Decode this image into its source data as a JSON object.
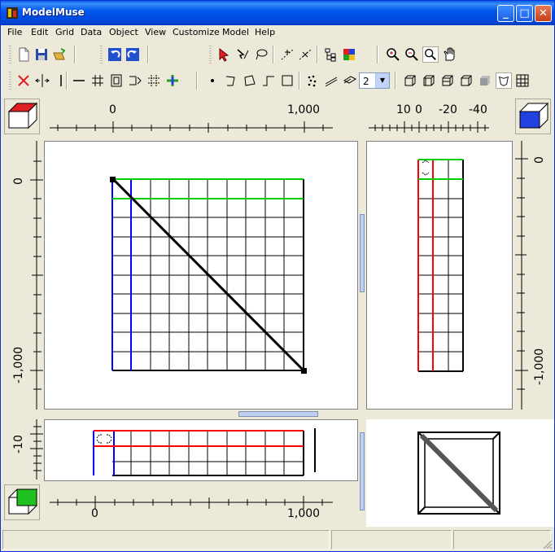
{
  "window": {
    "title": "ModelMuse",
    "minimize": "_",
    "maximize": "□",
    "close": "✕"
  },
  "menu": [
    "File",
    "Edit",
    "Grid",
    "Data",
    "Object",
    "View",
    "Customize",
    "Model",
    "Help"
  ],
  "toolbar": {
    "layer_value": "2"
  },
  "rulers": {
    "top": {
      "zero": "0",
      "end": "1,000"
    },
    "top_right": {
      "ten": "10",
      "zero": "0",
      "m20": "-20",
      "m40": "-40"
    },
    "left": {
      "zero": "0",
      "end": "-1,000"
    },
    "right": {
      "zero": "0",
      "end": "-1,000"
    },
    "bottom_left": {
      "m10": "-10"
    },
    "bottom": {
      "zero": "0",
      "end": "1,000"
    }
  },
  "icons": {
    "new": "new-file-icon",
    "save": "save-icon",
    "open": "open-icon",
    "undo": "undo-icon",
    "redo": "redo-icon",
    "select": "arrow-select-icon",
    "zoom_in": "zoom-in-icon",
    "zoom_out": "zoom-out-icon",
    "pan": "hand-pan-icon"
  },
  "colors": {
    "titlebar": "#0054e3",
    "grid_blue": "#0000ff",
    "grid_red": "#ff0000",
    "grid_green": "#00cc00"
  }
}
